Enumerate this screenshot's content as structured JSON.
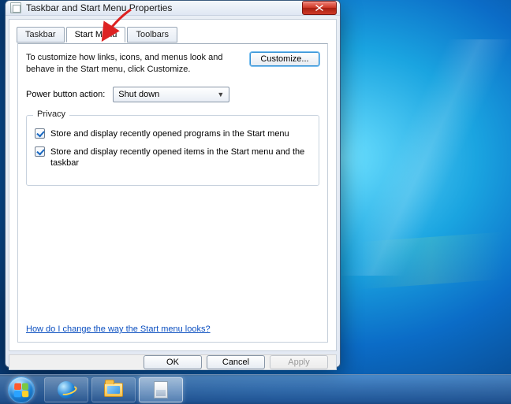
{
  "window": {
    "title": "Taskbar and Start Menu Properties",
    "tabs": [
      "Taskbar",
      "Start Menu",
      "Toolbars"
    ],
    "active_tab_index": 1
  },
  "startmenu": {
    "description": "To customize how links, icons, and menus look and behave in the Start menu, click Customize.",
    "customize_button": "Customize...",
    "power_label": "Power button action:",
    "power_value": "Shut down",
    "privacy": {
      "legend": "Privacy",
      "opt_programs": {
        "checked": true,
        "label": "Store and display recently opened programs in the Start menu"
      },
      "opt_items": {
        "checked": true,
        "label": "Store and display recently opened items in the Start menu and the taskbar"
      }
    },
    "help_link": "How do I change the way the Start menu looks?"
  },
  "footer": {
    "ok": "OK",
    "cancel": "Cancel",
    "apply": "Apply"
  },
  "taskbar": {
    "items": [
      {
        "name": "start",
        "active": false
      },
      {
        "name": "internet-explorer",
        "active": false
      },
      {
        "name": "file-explorer",
        "active": false
      },
      {
        "name": "taskbar-properties",
        "active": true
      }
    ]
  },
  "annotation": {
    "arrow_points_to": "Start Menu tab",
    "arrow_color": "#d22"
  }
}
